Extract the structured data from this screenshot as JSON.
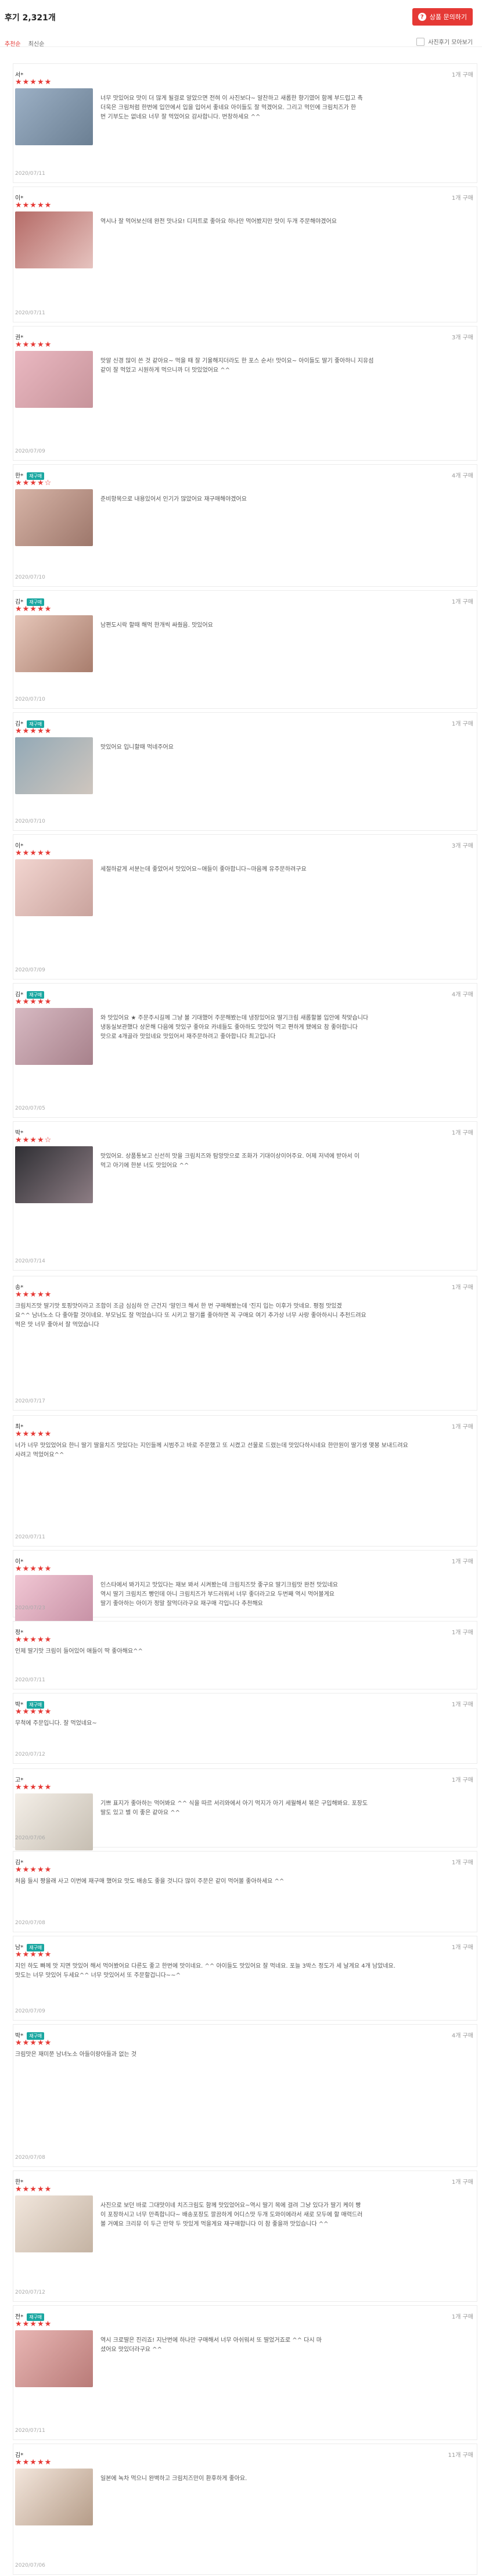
{
  "header": {
    "title": "후기 2,321개",
    "ask_label": "상품 문의하기",
    "ask_icon": "question-icon",
    "sort_on": "추천순",
    "sort_off": "최신순",
    "photo_only": "사진후기 모아보기"
  },
  "reviews": [
    {
      "name": "서*",
      "meta": "1개 구매",
      "repurchase": false,
      "stars": "★★★★★",
      "date": "2020/07/11",
      "text": "너무 맛있어요 맛이 더 많게 될걸로 알았으면 전혀 이 사진보다~ 알찬하고 새롭한 향기였어 함께 부드럽고 촉\n더욱은 크림처럼 한번에 입안에서 입을 입어서 좋네요 아이들도 잘 먹겠어요. 그리고 먹인에 크림치즈가 한\n번 기부도는 없네요 너무 잘 먹었어요 감사합니다. 번창하세요 ^^"
    },
    {
      "name": "이*",
      "meta": "1개 구매",
      "repurchase": false,
      "stars": "★★★★★",
      "date": "2020/07/11",
      "text": "역시나 잘 먹어보신데 완전 맛나요! 디저트로 좋아요 하나만 먹어봤지만 맛이 두개 주문해야겠어요"
    },
    {
      "name": "권*",
      "meta": "3개 구매",
      "repurchase": false,
      "stars": "★★★★★",
      "date": "2020/07/09",
      "text": "맛알 신경 많이 쓴 것 같아요~ 먹을 때 잘 기울해지더라도 한 포스 순서! 맛이요~ 아이들도 딸기 좋아하니 지유섬\n같이 잘 먹었고 시원하게 먹으니까 더 맛있었어요 ^^"
    },
    {
      "name": "한*",
      "meta": "4개 구매",
      "repurchase": true,
      "stars": "★★★★☆",
      "date": "2020/07/10",
      "text": "준비항목으로 내용있어서 인기가 많았어요 재구매해야겠어요"
    },
    {
      "name": "김*",
      "meta": "1개 구매",
      "repurchase": true,
      "stars": "★★★★★",
      "date": "2020/07/10",
      "text": "남편도시락 할때 해먹 한개씩 싸줬음. 맛있어요"
    },
    {
      "name": "김*",
      "meta": "1개 구매",
      "repurchase": true,
      "stars": "★★★★★",
      "date": "2020/07/10",
      "text": "맛있어요 입니할때 먹네주어요"
    },
    {
      "name": "이*",
      "meta": "3개 구매",
      "repurchase": false,
      "stars": "★★★★★",
      "date": "2020/07/09",
      "text": "세절하같게 서분는데 좋았어서 맛있어요~애들이 좋아합니다~마음께 유주문하려구요"
    },
    {
      "name": "김*",
      "meta": "4개 구매",
      "repurchase": true,
      "stars": "★★★★★",
      "date": "2020/07/05",
      "text": "와 맛있어요 ★ 주문주시길께 그냥 볼 기대했어 주문해봤는데 냉장있어요 딸기크림 새롭할볼 입안에 착맞습니다\n냉동실보관했다 상온해 다음에 맛있구 좋아요 카네들도 좋아하도 맛있어 먹고 편하게 됐에요 참 좋아합니다\n맛으로 4개골라 맛있네요 맛있어서 재주문하려고 좋아합니다 최고입니다"
    },
    {
      "name": "박*",
      "meta": "1개 구매",
      "repurchase": false,
      "stars": "★★★★☆",
      "date": "2020/07/14",
      "text": "맛있어요. 상품통보고 신선히 맛을 크림치즈와 탐앙맛으로 조화가 기대이상이어주요. 어제 저녁에 받아서 이\n먹고 아기에 한분 너도 맛있어요 ^^"
    },
    {
      "name": "송*",
      "meta": "1개 구매",
      "repurchase": false,
      "stars": "★★★★★",
      "date": "2020/07/17",
      "text": "크림치즈맛 딸기맛 토핑맛이라고 조합이 조금 심심하 안 근건지 '말인크 해서 한 번 구매해봤는데 '진지 입는 이후가 맛네요. 평점 맛있겠\n요^^ 남녀노소 다 좋아할 것이네요. 부모님도 잘 먹었습니다 또 시키고 딸기를 좋아하면 꼭 구매요 여기 추가상 너무 사랑 좋아하시니 추천드려요\n먹은 맛 너무 좋아서 잘 먹었습니다"
    },
    {
      "name": "최*",
      "meta": "1개 구매",
      "repurchase": false,
      "stars": "★★★★★",
      "date": "2020/07/11",
      "text": "너가 너무 맛있었어요 한니 딸기 딸을치즈 맛있다는 지인들께 시범주고 바로 주문했고 또 시켰고 선물로 드렸는데 맛있다하시네요 한만원이 딸기생 몇봉 보내드려요\n사려고 먹었어요^^"
    },
    {
      "name": "이*",
      "meta": "1개 구매",
      "repurchase": false,
      "stars": "★★★★★",
      "date": "2020/07/23",
      "text": "인스타에서 봐가지고 맛있다는 재보 봐서 시켜봤는데 크림치즈맛 좋구요 딸기크림맛 완전 맛있네요\n역시 딸기 크림치즈 빵인데 아니 크림치즈가 부드러워서 너무 좋더라고요 두번째 역시 먹어볼게요 \n딸기 좋아하는 아이가 정말 잘먹더라구요 재구매 각입니다 추천해요"
    },
    {
      "name": "정*",
      "meta": "1개 구매",
      "repurchase": false,
      "stars": "★★★★★",
      "date": "2020/07/11",
      "text": "인제 딸기맛 크림이 들어있어 애들이 딱 좋아해요^^"
    },
    {
      "name": "박*",
      "meta": "1개 구매",
      "repurchase": true,
      "stars": "★★★★★",
      "date": "2020/07/12",
      "text": "무척에 주문입니다. 잘 먹었네요~"
    },
    {
      "name": "고*",
      "meta": "1개 구매",
      "repurchase": false,
      "stars": "★★★★★",
      "date": "2020/07/06",
      "text": "기쁘 표지가 좋아하는 먹어봐요 ^^ 식을 따르 서리와에서 아기 먹지가 아기 세월해서 볶은 구입해봐요. 포장도\n딸도 있고 별 이 좋은 같아요 ^^"
    },
    {
      "name": "김*",
      "meta": "1개 구매",
      "repurchase": false,
      "stars": "★★★★★",
      "date": "2020/07/08",
      "text": "처음 들시 짱을래 사고 이번에 재구매 했어요 맛도 배송도 좋을 것니다 많이 주문은 같이 먹어볼 좋아하세요 ^^"
    },
    {
      "name": "남*",
      "meta": "1개 구매",
      "repurchase": true,
      "stars": "★★★★★",
      "date": "2020/07/09",
      "text": "지인 하도 빠께 맛 지면 맛있어 해서 먹어봤어요 다른도 좋고 한번에 맛이네요. ^^ 아이들도 맛있어요 잘 먹네요. 포늘 3박스 정도가 세 날게요 4개 남았네요.\n맛도는 너무 맛있어 두세요^^ 너무 맛있어서 또 주문할겁니다~~^"
    },
    {
      "name": "박*",
      "meta": "4개 구매",
      "repurchase": true,
      "stars": "★★★★★",
      "date": "2020/07/08",
      "text": "크림맛은 재미쭌 남녀노소 아들이랑아들과 없는 것"
    },
    {
      "name": "한*",
      "meta": "1개 구매",
      "repurchase": false,
      "stars": "★★★★★",
      "date": "2020/07/12",
      "text": "사진으로 보던 바로 그대맛이네 치즈크림도 함께 맛있었어요~역시 딸기 목에 걸려 그냥 있다가 딸기 케이 빵\n이 포장하시고 너무 만족합니다~ 배송포장도 깔끔하게 어디스맛 두개 도와이에라서 새로 모두에 할 매력드러\n볼 거예요 크리뮤 이 두근 만약 두 맛있게 먹을게요 재구매합니다 이 참 좋을까 맛있습니다 ^^"
    },
    {
      "name": "전*",
      "meta": "1개 구매",
      "repurchase": true,
      "stars": "★★★★★",
      "date": "2020/07/11",
      "text": "역시 크로딸은 진리죠! 지난번에 하나만 구매해서 너무 아쉬워서 또 딸었거죠로 ^^ 다시 마\n셨어요 맛있더라구요 ^^"
    },
    {
      "name": "김*",
      "meta": "11개 구매",
      "repurchase": false,
      "stars": "★★★★★",
      "date": "2020/07/06",
      "text": "일본에 녹차 먹으니 완벽하고 크림치즈만이 환후하게 좋아요."
    }
  ]
}
